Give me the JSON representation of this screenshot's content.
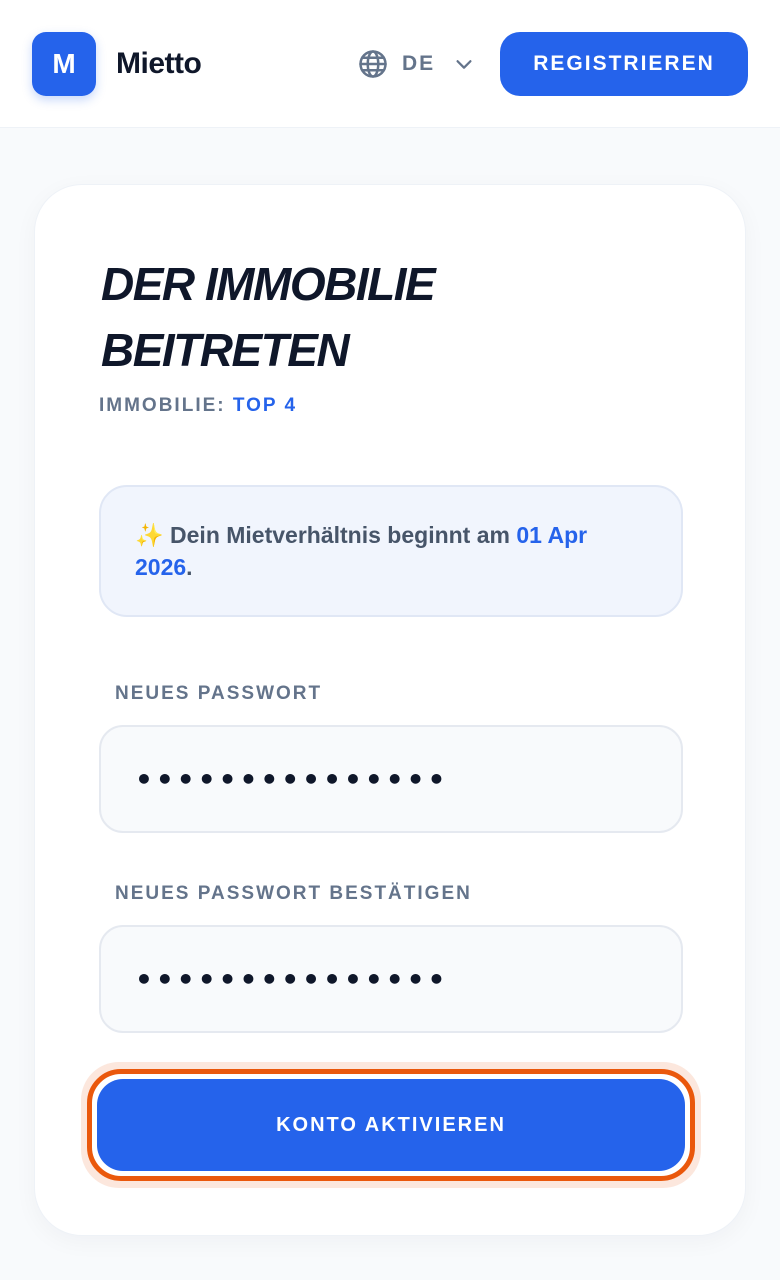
{
  "header": {
    "logo_letter": "M",
    "brand": "Mietto",
    "language": {
      "code": "DE",
      "icon": "globe-icon",
      "dropdown_icon": "chevron-down-icon"
    },
    "register_label": "REGISTRIEREN"
  },
  "card": {
    "title_line1": "DER IMMOBILIE",
    "title_line2": "BEITRETEN",
    "property_label": "IMMOBILIE:",
    "property_value": "TOP 4",
    "notice": {
      "emoji": "✨",
      "text": "Dein Mietverhältnis beginnt am",
      "date": "01 Apr 2026",
      "end": "."
    },
    "new_password": {
      "label": "NEUES PASSWORT",
      "value": "•••••••••••••••"
    },
    "confirm_password": {
      "label": "NEUES PASSWORT BESTÄTIGEN",
      "value": "•••••••••••••••"
    },
    "activate_label": "KONTO AKTIVIEREN"
  },
  "colors": {
    "primary": "#2563eb",
    "highlight_ring": "#ea580c",
    "muted_text": "#64748b",
    "heading": "#0f172a"
  }
}
